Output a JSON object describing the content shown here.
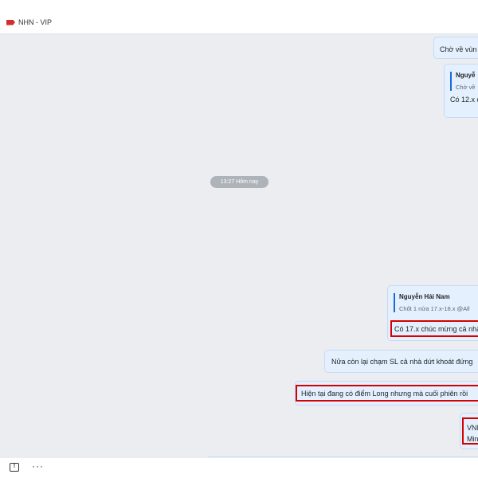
{
  "header": {
    "title": "NHN - VIP"
  },
  "messages": {
    "m1": {
      "text": "Chờ về vùn"
    },
    "m2": {
      "quote_author": "Nguyễ",
      "quote_text": "Chờ về",
      "text": "Có 12.x c"
    },
    "time_divider": "13:27 Hôm nay",
    "m3": {
      "quote_author": "Nguyễn Hải Nam",
      "quote_text": "Chốt 1 nửa 17.x-18.x @All",
      "text": "Có 17.x chúc mừng cả nhà"
    },
    "m4": {
      "text": "Nửa còn lại chạm SL cả nhà dứt khoát đứng"
    },
    "m5": {
      "text": "Hiện tại đang có điểm Long nhưng mà cuối phiên rồi"
    },
    "m6": {
      "line1": "VNI",
      "line2": "Min"
    }
  },
  "footer": {
    "feedback_icon": "feedback-icon",
    "more_icon": "more-options-icon"
  },
  "colors": {
    "bubble": "#e4f0fd",
    "highlight": "#d60000",
    "background": "#ebedf0"
  }
}
